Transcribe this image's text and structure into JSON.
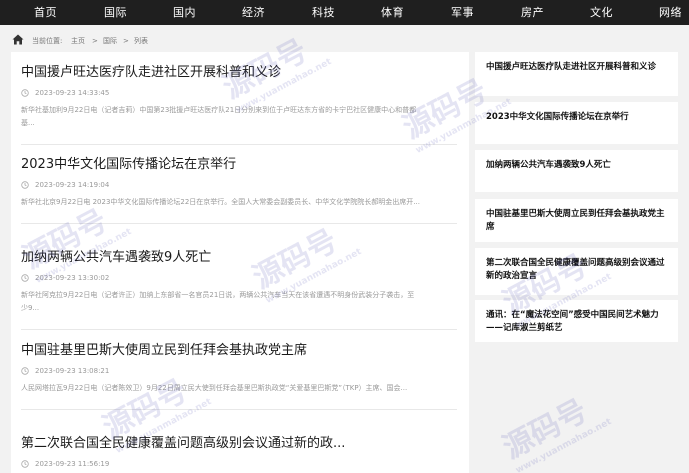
{
  "nav": {
    "items": [
      "首页",
      "国际",
      "国内",
      "经济",
      "科技",
      "体育",
      "军事",
      "房产",
      "文化",
      "网络"
    ]
  },
  "breadcrumb": {
    "prefix": "当前位置:",
    "home": "主页",
    "sep1": ">",
    "section": "国际",
    "sep2": ">",
    "current": "列表"
  },
  "articles": [
    {
      "title": "中国援卢旺达医疗队走进社区开展科普和义诊",
      "date": "2023-09-23 14:33:45",
      "summary": "新华社基加利9月22日电（记者吉莉）中国第23批援卢旺达医疗队21日分别来到位于卢旺达东方省的卡宁巴社区健康中心和普都基..."
    },
    {
      "title": "2023中华文化国际传播论坛在京举行",
      "date": "2023-09-23 14:19:04",
      "summary": "新华社北京9月22日电 2023中华文化国际传播论坛22日在京举行。全国人大常委会副委员长、中华文化学院院长郝明金出席开..."
    },
    {
      "title": "加纳两辆公共汽车遇袭致9人死亡",
      "date": "2023-09-23 13:30:02",
      "summary": "新华社阿克拉9月22日电（记者许正）加纳上东部省一名官员21日说，两辆公共汽车当天在该省遭遇不明身份武装分子袭击，至少9..."
    },
    {
      "title": "中国驻基里巴斯大使周立民到任拜会基执政党主席",
      "date": "2023-09-23 13:08:21",
      "summary": "人民网塔拉瓦9月22日电（记者陈效卫）9月22日周立民大使到任拜会基里巴斯执政党“关爱基里巴斯党”（TKP）主席、国会..."
    },
    {
      "title": "第二次联合国全民健康覆盖问题高级别会议通过新的政...",
      "date": "2023-09-23 11:56:19",
      "summary": ""
    }
  ],
  "sidebar": {
    "items": [
      "中国援卢旺达医疗队走进社区开展科普和义诊",
      "2023中华文化国际传播论坛在京举行",
      "加纳两辆公共汽车遇袭致9人死亡",
      "中国驻基里巴斯大使周立民到任拜会基执政党主席",
      "第二次联合国全民健康覆盖问题高级别会议通过新的政治宣言",
      "通讯：在“魔法花空间”感受中国民间艺术魅力——记库淑兰剪纸艺"
    ]
  },
  "watermark": {
    "text": "源码号",
    "url": "www.yuanmahao.net"
  },
  "colors": {
    "nav_bg": "#1f1f1f",
    "page_bg": "#f2f2f2",
    "watermark": "#3a3aa8"
  }
}
